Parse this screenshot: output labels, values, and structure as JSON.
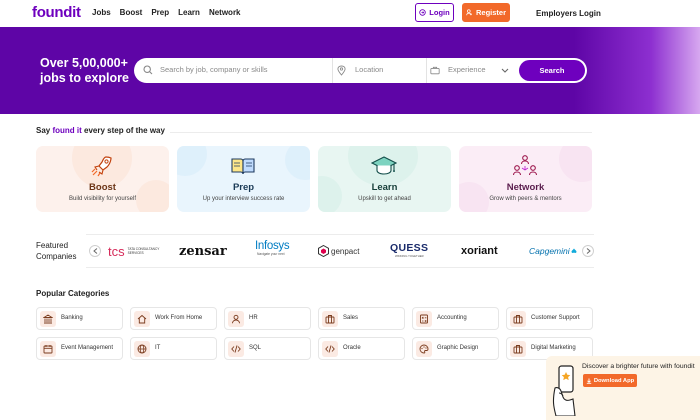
{
  "header": {
    "logo": "foundit",
    "nav": [
      "Jobs",
      "Boost",
      "Prep",
      "Learn",
      "Network"
    ],
    "login_label": "Login",
    "register_label": "Register",
    "employers_label": "Employers Login"
  },
  "hero": {
    "title_line1": "Over 5,00,000+",
    "title_line2": "jobs to explore",
    "search_placeholder": "Search by job, company or skills",
    "location_placeholder": "Location",
    "experience_placeholder": "Experience",
    "search_button": "Search"
  },
  "section": {
    "say_prefix": "Say ",
    "say_brand": "found it",
    "say_suffix": " every step of the way"
  },
  "cards": [
    {
      "title": "Boost",
      "subtitle": "Build visibility for yourself",
      "icon": "rocket-icon",
      "bg": "#fdf1ec",
      "title_color": "#6d3516"
    },
    {
      "title": "Prep",
      "subtitle": "Up your interview success rate",
      "icon": "book-icon",
      "bg": "#e9f5fd",
      "title_color": "#1a3a56"
    },
    {
      "title": "Learn",
      "subtitle": "Upskill to get ahead",
      "icon": "graduation-cap-icon",
      "bg": "#e8f6f2",
      "title_color": "#15403a"
    },
    {
      "title": "Network",
      "subtitle": "Grow with peers & mentors",
      "icon": "people-network-icon",
      "bg": "#fbedf6",
      "title_color": "#5a1d4d"
    }
  ],
  "featured": {
    "label_line1": "Featured",
    "label_line2": "Companies",
    "companies": [
      "TCS",
      "zensar",
      "Infosys",
      "genpact",
      "QUESS",
      "xoriant",
      "Capgemini"
    ],
    "tcs_sub": "TATA CONSULTANCY SERVICES",
    "infosys_sub": "Navigate your next",
    "quess_sub": "WINNING TOGETHER"
  },
  "popular": {
    "title": "Popular Categories",
    "categories": [
      {
        "label": "Banking",
        "icon": "bank-icon"
      },
      {
        "label": "Work From Home",
        "icon": "home-icon"
      },
      {
        "label": "HR",
        "icon": "user-icon"
      },
      {
        "label": "Sales",
        "icon": "briefcase-icon"
      },
      {
        "label": "Accounting",
        "icon": "calculator-icon"
      },
      {
        "label": "Customer Support",
        "icon": "briefcase-icon"
      },
      {
        "label": "Event Management",
        "icon": "calendar-icon"
      },
      {
        "label": "IT",
        "icon": "globe-icon"
      },
      {
        "label": "SQL",
        "icon": "code-icon"
      },
      {
        "label": "Oracle",
        "icon": "code-icon"
      },
      {
        "label": "Graphic Design",
        "icon": "palette-icon"
      },
      {
        "label": "Digital Marketing",
        "icon": "briefcase-icon"
      }
    ]
  },
  "promo": {
    "text": "Discover a brighter future with foundit",
    "button": "Download App"
  },
  "colors": {
    "brand": "#6e00be",
    "accent": "#f2692a",
    "hero_bg": "#5e05a6"
  }
}
